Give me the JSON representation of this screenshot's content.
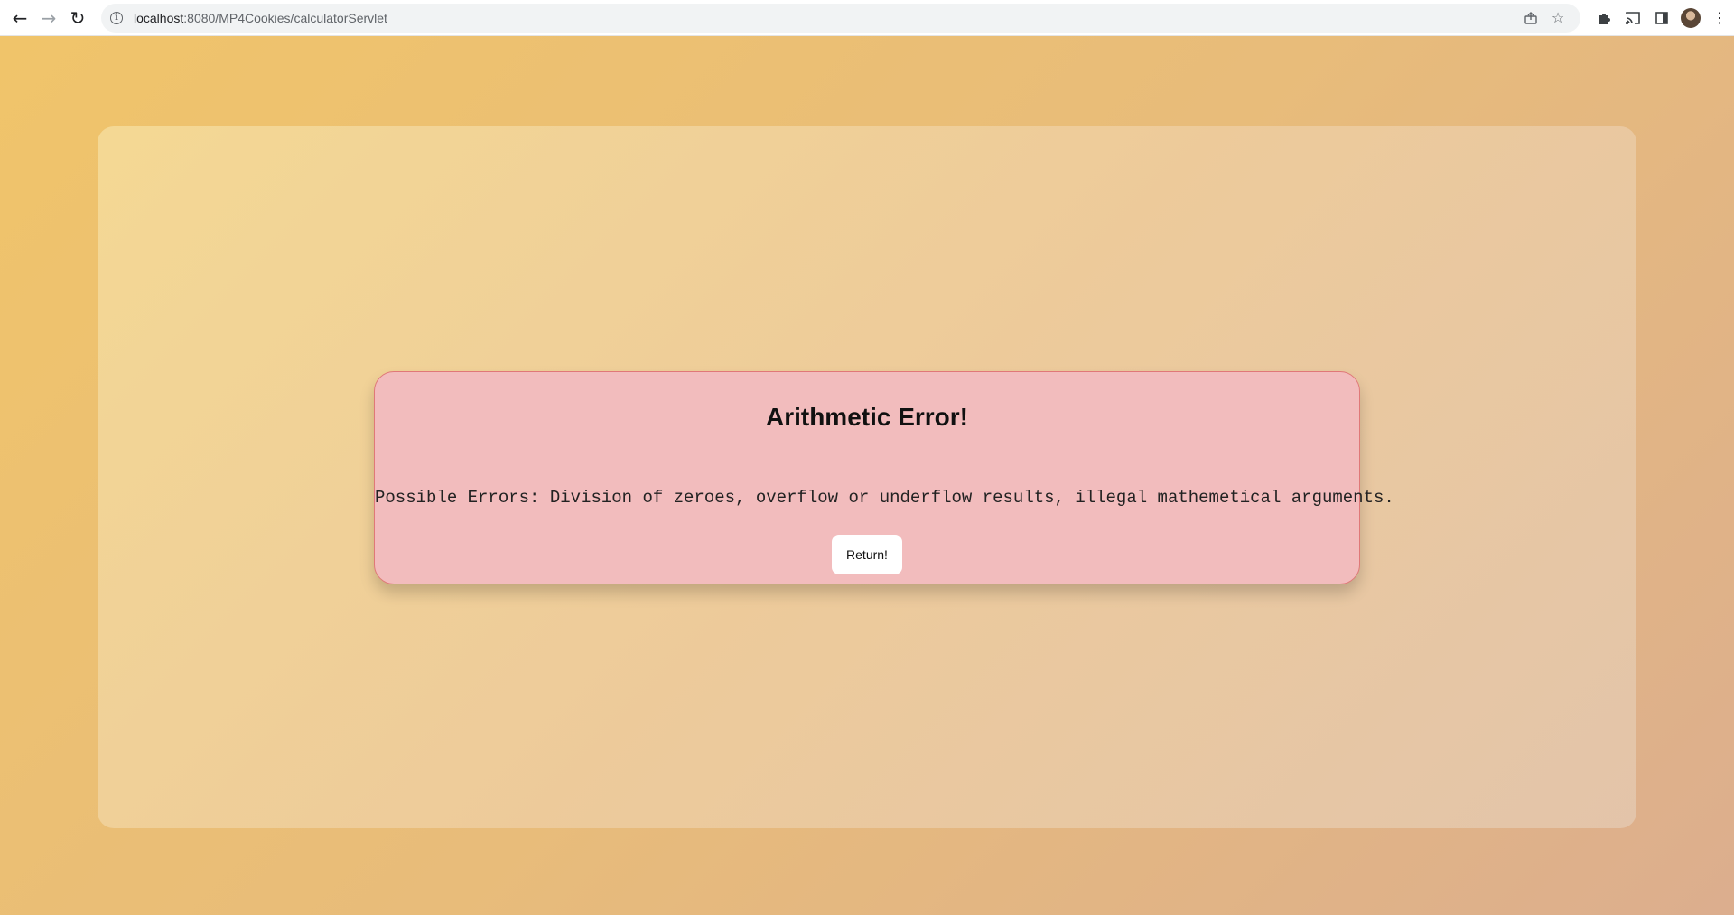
{
  "browser": {
    "url_host": "localhost",
    "url_path": ":8080/MP4Cookies/calculatorServlet",
    "icons": {
      "back": "arrow-left-icon",
      "forward": "arrow-right-icon",
      "reload": "reload-icon",
      "site_info": "info-icon",
      "share": "share-icon",
      "bookmark": "star-icon",
      "extensions": "puzzle-icon",
      "cast": "cast-icon",
      "side_panel": "side-panel-icon",
      "profile": "avatar",
      "menu": "kebab-menu-icon"
    }
  },
  "error_card": {
    "title": "Arithmetic Error!",
    "message": "Possible Errors: Division of zeroes, overflow or underflow results, illegal mathemetical arguments.",
    "return_label": "Return!"
  },
  "colors": {
    "background_start": "#f0c46a",
    "background_end": "#dcae8e",
    "card_fill": "#f2bcbd",
    "card_border": "#e07878",
    "button_fill": "#ffffff"
  }
}
